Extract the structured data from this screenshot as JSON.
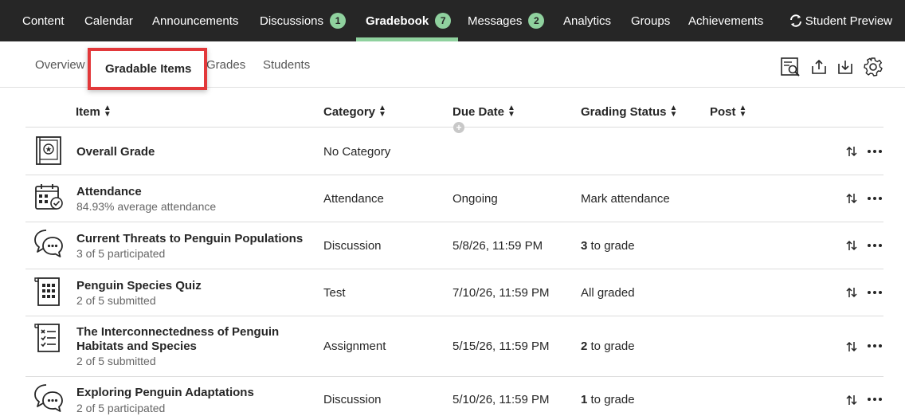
{
  "topnav": {
    "items": [
      {
        "label": "Content"
      },
      {
        "label": "Calendar"
      },
      {
        "label": "Announcements"
      },
      {
        "label": "Discussions",
        "badge": "1"
      },
      {
        "label": "Gradebook",
        "badge": "7"
      },
      {
        "label": "Messages",
        "badge": "2"
      },
      {
        "label": "Analytics"
      },
      {
        "label": "Groups"
      },
      {
        "label": "Achievements"
      }
    ],
    "student_preview": "Student Preview",
    "badge_color": "#8fd19e"
  },
  "subnav": {
    "tabs": [
      {
        "label": "Overview"
      },
      {
        "label": "Gradable Items"
      },
      {
        "label": "Grades"
      },
      {
        "label": "Students"
      }
    ],
    "active_tab": "Gradable Items",
    "highlight_color": "#e2383a"
  },
  "table": {
    "headers": {
      "item": "Item",
      "category": "Category",
      "due_date": "Due Date",
      "grading_status": "Grading Status",
      "post": "Post"
    },
    "rows": [
      {
        "icon": "gradebook-book-icon",
        "title": "Overall Grade",
        "sub": "",
        "category": "No Category",
        "due": "",
        "status_num": "",
        "status_text": ""
      },
      {
        "icon": "attendance-calendar-icon",
        "title": "Attendance",
        "sub": "84.93% average attendance",
        "category": "Attendance",
        "due": "Ongoing",
        "status_num": "",
        "status_text": "Mark attendance"
      },
      {
        "icon": "discussion-icon",
        "title": "Current Threats to Penguin Populations",
        "sub": "3 of 5 participated",
        "category": "Discussion",
        "due": "5/8/26, 11:59 PM",
        "status_num": "3",
        "status_text": " to grade"
      },
      {
        "icon": "test-icon",
        "title": "Penguin Species Quiz",
        "sub": "2 of 5 submitted",
        "category": "Test",
        "due": "7/10/26, 11:59 PM",
        "status_num": "",
        "status_text": "All graded"
      },
      {
        "icon": "assignment-icon",
        "title_line1": "The Interconnectedness of Penguin",
        "title_line2": "Habitats and Species",
        "sub": "2 of 5 submitted",
        "category": "Assignment",
        "due": "5/15/26, 11:59 PM",
        "status_num": "2",
        "status_text": " to grade"
      },
      {
        "icon": "discussion-icon",
        "title": "Exploring Penguin Adaptations",
        "sub": "2 of 5 participated",
        "category": "Discussion",
        "due": "5/10/26, 11:59 PM",
        "status_num": "1",
        "status_text": " to grade"
      }
    ]
  }
}
